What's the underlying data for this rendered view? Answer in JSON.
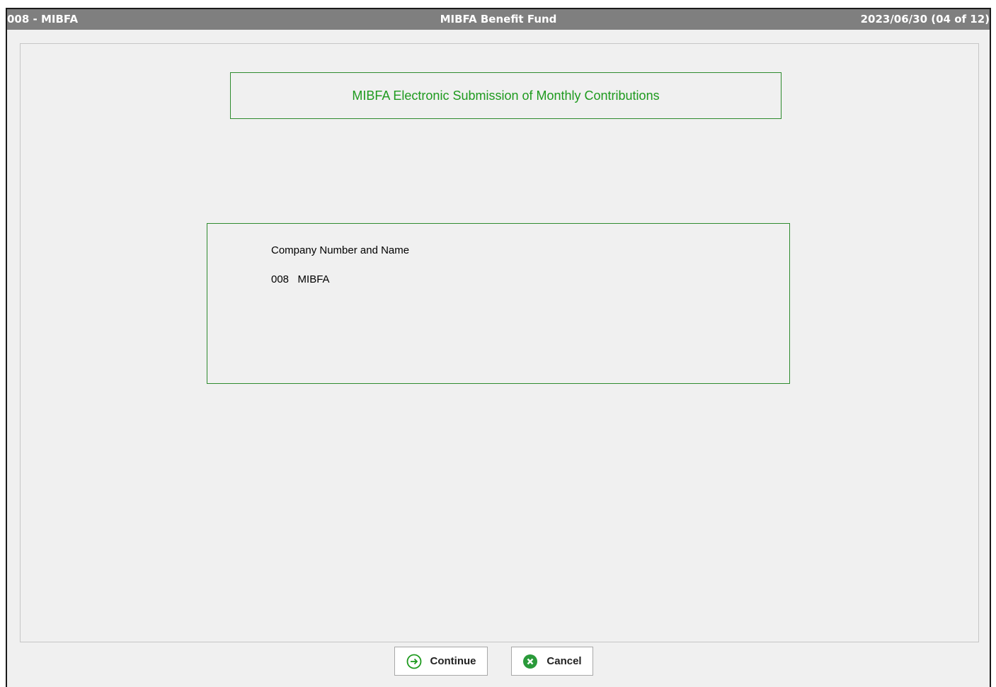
{
  "titlebar": {
    "left": "008 - MIBFA",
    "center": "MIBFA Benefit Fund",
    "right": "2023/06/30 (04 of 12)"
  },
  "heading": "MIBFA Electronic Submission of Monthly Contributions",
  "company": {
    "label": "Company Number and Name",
    "value": "008   MIBFA"
  },
  "buttons": {
    "continue_label": "Continue",
    "cancel_label": "Cancel"
  },
  "icons": {
    "continue": "arrow-right-circle-icon",
    "cancel": "close-circle-icon"
  },
  "colors": {
    "accent_green": "#1e9a1e",
    "titlebar_bg": "#7f7f7f"
  }
}
